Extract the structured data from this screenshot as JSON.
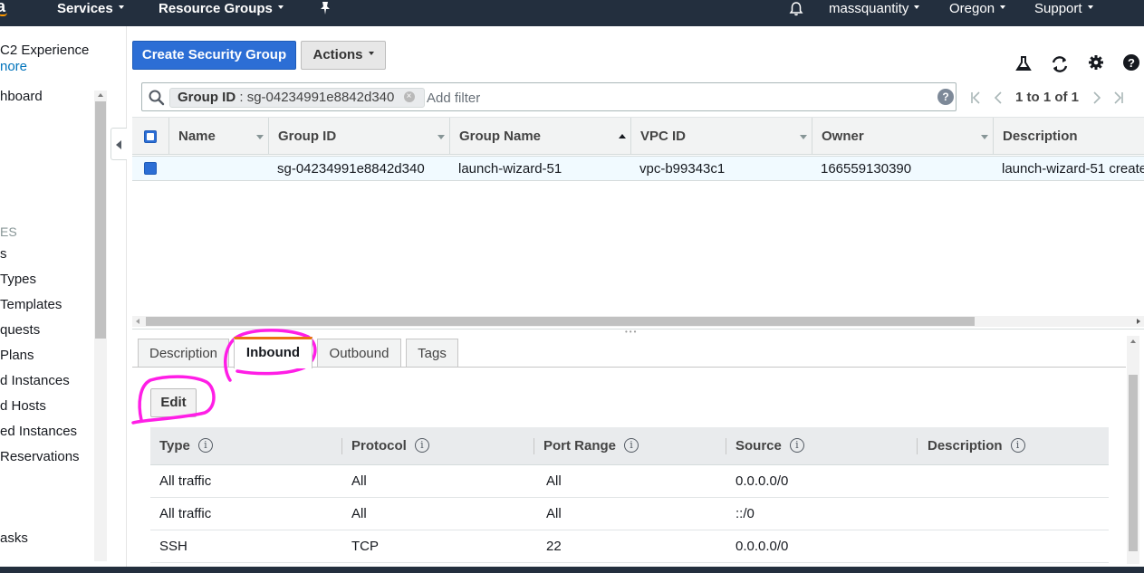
{
  "topnav": {
    "services": "Services",
    "resource_groups": "Resource Groups",
    "account": "massquantity",
    "region": "Oregon",
    "support": "Support",
    "icons": [
      "aws-logo",
      "pin-icon",
      "bell-icon"
    ]
  },
  "sidebar": {
    "experience_line": "C2 Experience",
    "learn_more": "nore",
    "dashboard": "hboard",
    "section_header": "ES",
    "items": [
      "s",
      " Types",
      "Templates",
      "quests",
      "Plans",
      "d Instances",
      "d Hosts",
      "ed Instances",
      " Reservations",
      "asks"
    ]
  },
  "toolbar": {
    "create_label": "Create Security Group",
    "actions_label": "Actions",
    "icons": [
      "flask-icon",
      "refresh-icon",
      "gear-icon",
      "help-icon"
    ]
  },
  "filter": {
    "chip_key": "Group ID",
    "chip_sep": " : ",
    "chip_value": "sg-04234991e8842d340",
    "placeholder": "Add filter",
    "help": "?"
  },
  "pagination": {
    "text": "1 to 1 of 1"
  },
  "table": {
    "columns": [
      "Name",
      "Group ID",
      "Group Name",
      "VPC ID",
      "Owner",
      "Description"
    ],
    "rows": [
      {
        "name": "",
        "group_id": "sg-04234991e8842d340",
        "group_name": "launch-wizard-51",
        "vpc_id": "vpc-b99343c1",
        "owner": "166559130390",
        "description": "launch-wizard-51 create"
      }
    ]
  },
  "tabs": [
    "Description",
    "Inbound",
    "Outbound",
    "Tags"
  ],
  "active_tab": "Inbound",
  "inbound": {
    "edit_label": "Edit",
    "columns": [
      "Type",
      "Protocol",
      "Port Range",
      "Source",
      "Description"
    ],
    "rows": [
      {
        "type": "All traffic",
        "protocol": "All",
        "port_range": "All",
        "source": "0.0.0.0/0",
        "description": ""
      },
      {
        "type": "All traffic",
        "protocol": "All",
        "port_range": "All",
        "source": "::/0",
        "description": ""
      },
      {
        "type": "SSH",
        "protocol": "TCP",
        "port_range": "22",
        "source": "0.0.0.0/0",
        "description": ""
      }
    ]
  },
  "colors": {
    "nav_bg": "#232f3e",
    "primary": "#2c6ed5",
    "annotation": "#ff1ee6",
    "active_tab_accent": "#ec7211"
  }
}
